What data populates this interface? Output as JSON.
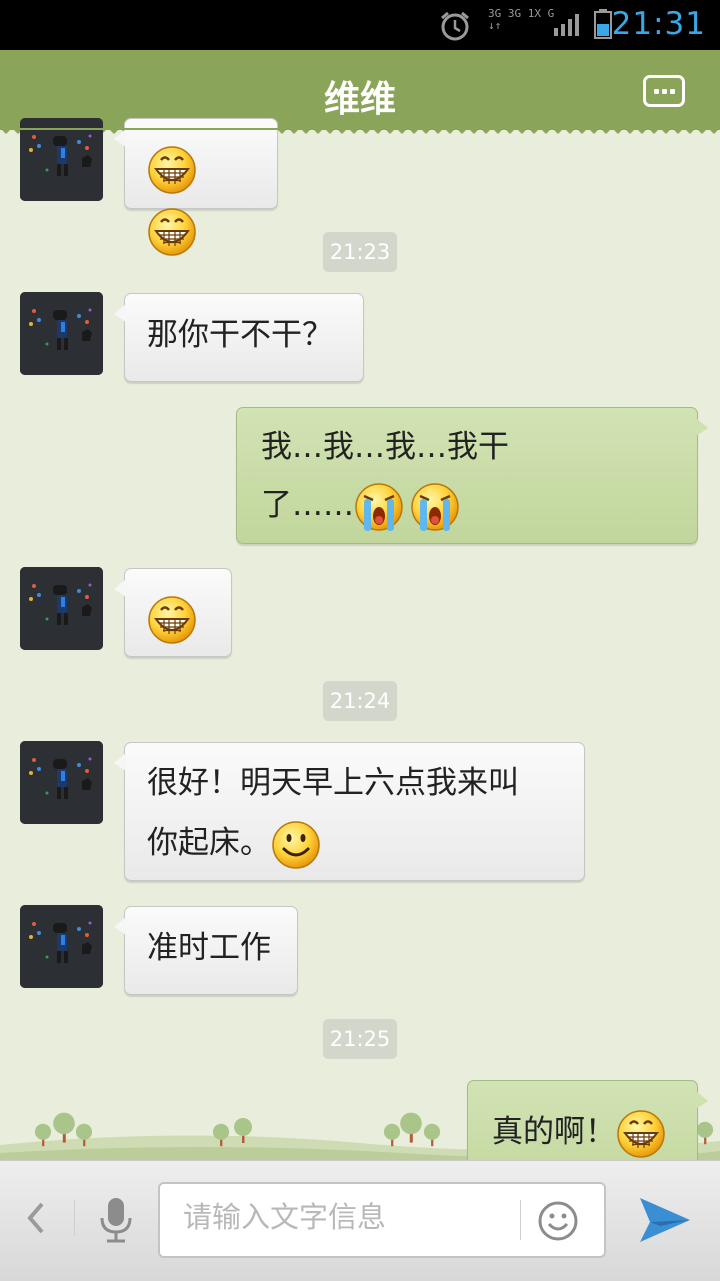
{
  "status": {
    "time": "21:31",
    "net_top": "3G 3G 1X G",
    "net_bottom": "↓↑"
  },
  "header": {
    "title": "维维"
  },
  "messages": {
    "m1_text": "那你干不干？",
    "m2_line1": "我…我…我…我干",
    "m2_line2": "了……",
    "m4_line1": "很好！明天早上六点我来叫",
    "m4_line2": "你起床。",
    "m5_text": "准时工作",
    "m6_text": "真的啊！"
  },
  "timestamps": {
    "t1": "21:23",
    "t2": "21:24",
    "t3": "21:25"
  },
  "input": {
    "placeholder": "请输入文字信息"
  },
  "icons": {
    "back": "chevron-left-icon",
    "mic": "microphone-icon",
    "emoji": "smiley-icon",
    "send": "send-arrow-icon",
    "menu": "more-options-icon"
  },
  "colors": {
    "header": "#8aa45a",
    "time_text": "#3aa8e6",
    "outgoing_bubble": "#c8dba6",
    "send_icon": "#3a8fd4"
  }
}
